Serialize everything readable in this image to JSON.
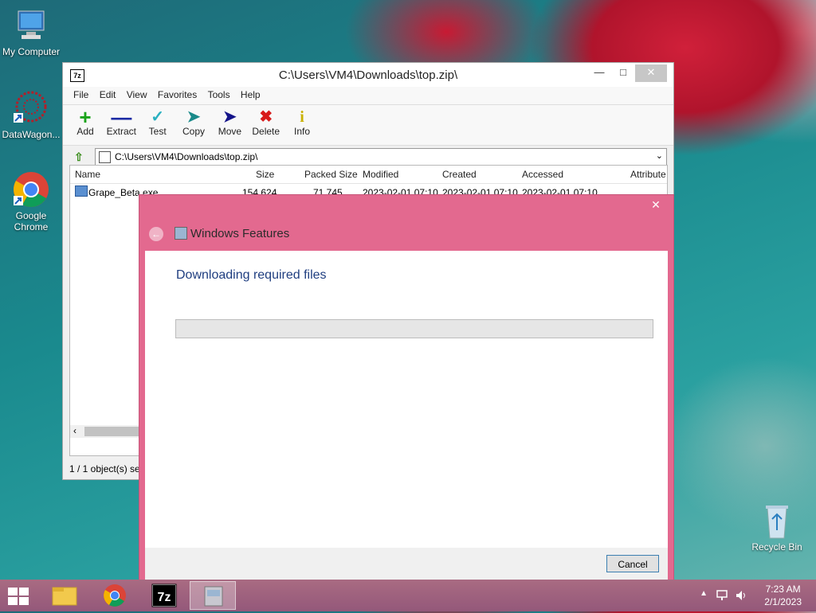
{
  "desktop": {
    "icons": [
      {
        "label": "My Computer"
      },
      {
        "label": "DataWagon..."
      },
      {
        "label": "Google Chrome"
      },
      {
        "label": "Recycle Bin"
      }
    ]
  },
  "zip_window": {
    "title": "C:\\Users\\VM4\\Downloads\\top.zip\\",
    "app_icon_text": "7z",
    "menu": [
      "File",
      "Edit",
      "View",
      "Favorites",
      "Tools",
      "Help"
    ],
    "toolbar": [
      {
        "label": "Add",
        "icon": "plus-icon",
        "color": "#1aa31a"
      },
      {
        "label": "Extract",
        "icon": "minus-icon",
        "color": "#1a2aa3"
      },
      {
        "label": "Test",
        "icon": "check-icon",
        "color": "#2ab0c0"
      },
      {
        "label": "Copy",
        "icon": "copy-arrow-icon",
        "color": "#1a8a8a"
      },
      {
        "label": "Move",
        "icon": "move-arrow-icon",
        "color": "#14148a"
      },
      {
        "label": "Delete",
        "icon": "delete-icon",
        "color": "#d81a1a"
      },
      {
        "label": "Info",
        "icon": "info-icon",
        "color": "#c8b000"
      }
    ],
    "address": "C:\\Users\\VM4\\Downloads\\top.zip\\",
    "columns": [
      "Name",
      "Size",
      "Packed Size",
      "Modified",
      "Created",
      "Accessed",
      "Attribute"
    ],
    "rows": [
      {
        "name": "Grape_Beta.exe",
        "size": "154 624",
        "packed": "71 745",
        "modified": "2023-02-01 07:10",
        "created": "2023-02-01 07:10",
        "accessed": "2023-02-01 07:10"
      }
    ],
    "status": "1 / 1 object(s) se"
  },
  "features_dialog": {
    "title": "Windows Features",
    "heading": "Downloading required files",
    "progress": 0,
    "cancel_label": "Cancel",
    "accent": "#e3698f"
  },
  "taskbar": {
    "apps": [
      "file-explorer",
      "google-chrome",
      "7-zip",
      "windows-features"
    ],
    "time": "7:23 AM",
    "date": "2/1/2023"
  }
}
